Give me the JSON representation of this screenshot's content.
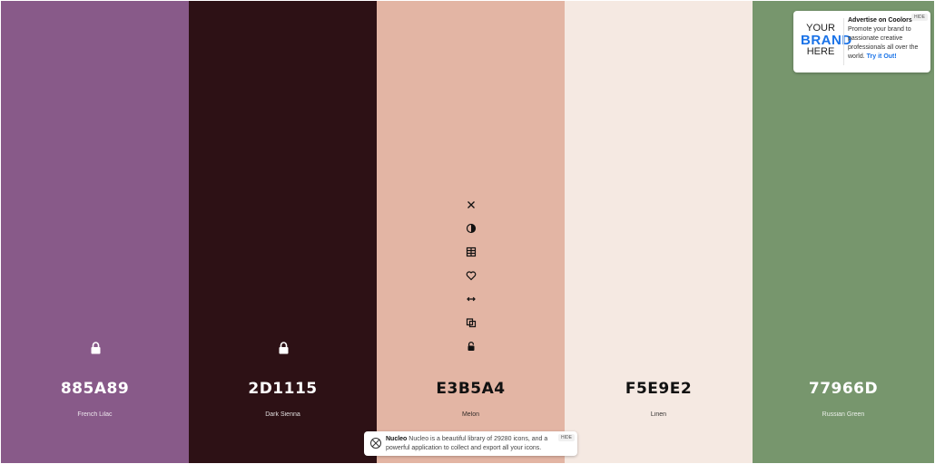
{
  "palette": {
    "colors": [
      {
        "hex": "885A89",
        "name": "French Lilac",
        "color": "#885a89",
        "text_color": "#ffffff",
        "locked": true
      },
      {
        "hex": "2D1115",
        "name": "Dark Sienna",
        "color": "#2d1115",
        "text_color": "#ffffff",
        "locked": true
      },
      {
        "hex": "E3B5A4",
        "name": "Melon",
        "color": "#e3b5a4",
        "text_color": "#111111",
        "locked": false
      },
      {
        "hex": "F5E9E2",
        "name": "Linen",
        "color": "#f5e9e2",
        "text_color": "#111111",
        "locked": false
      },
      {
        "hex": "77966D",
        "name": "Russian Green",
        "color": "#77966d",
        "text_color": "#ffffff",
        "locked": false
      }
    ],
    "hover_tools": [
      "remove-icon",
      "contrast-icon",
      "view-shades-icon",
      "favorite-icon",
      "drag-icon",
      "copy-icon",
      "lock-icon"
    ]
  },
  "ad": {
    "logo_line1": "YOUR",
    "logo_line2": "BRAND",
    "logo_line3": "HERE",
    "title": "Advertise on Coolors",
    "text": "Promote your brand to passionate creative professionals all over the world.",
    "link": "Try it Out!",
    "badge": "HIDE"
  },
  "notice": {
    "title": "Nucleo",
    "text": "Nucleo is a beautiful library of 29280 icons, and a powerful application to collect and export all your icons.",
    "badge": "HIDE"
  }
}
